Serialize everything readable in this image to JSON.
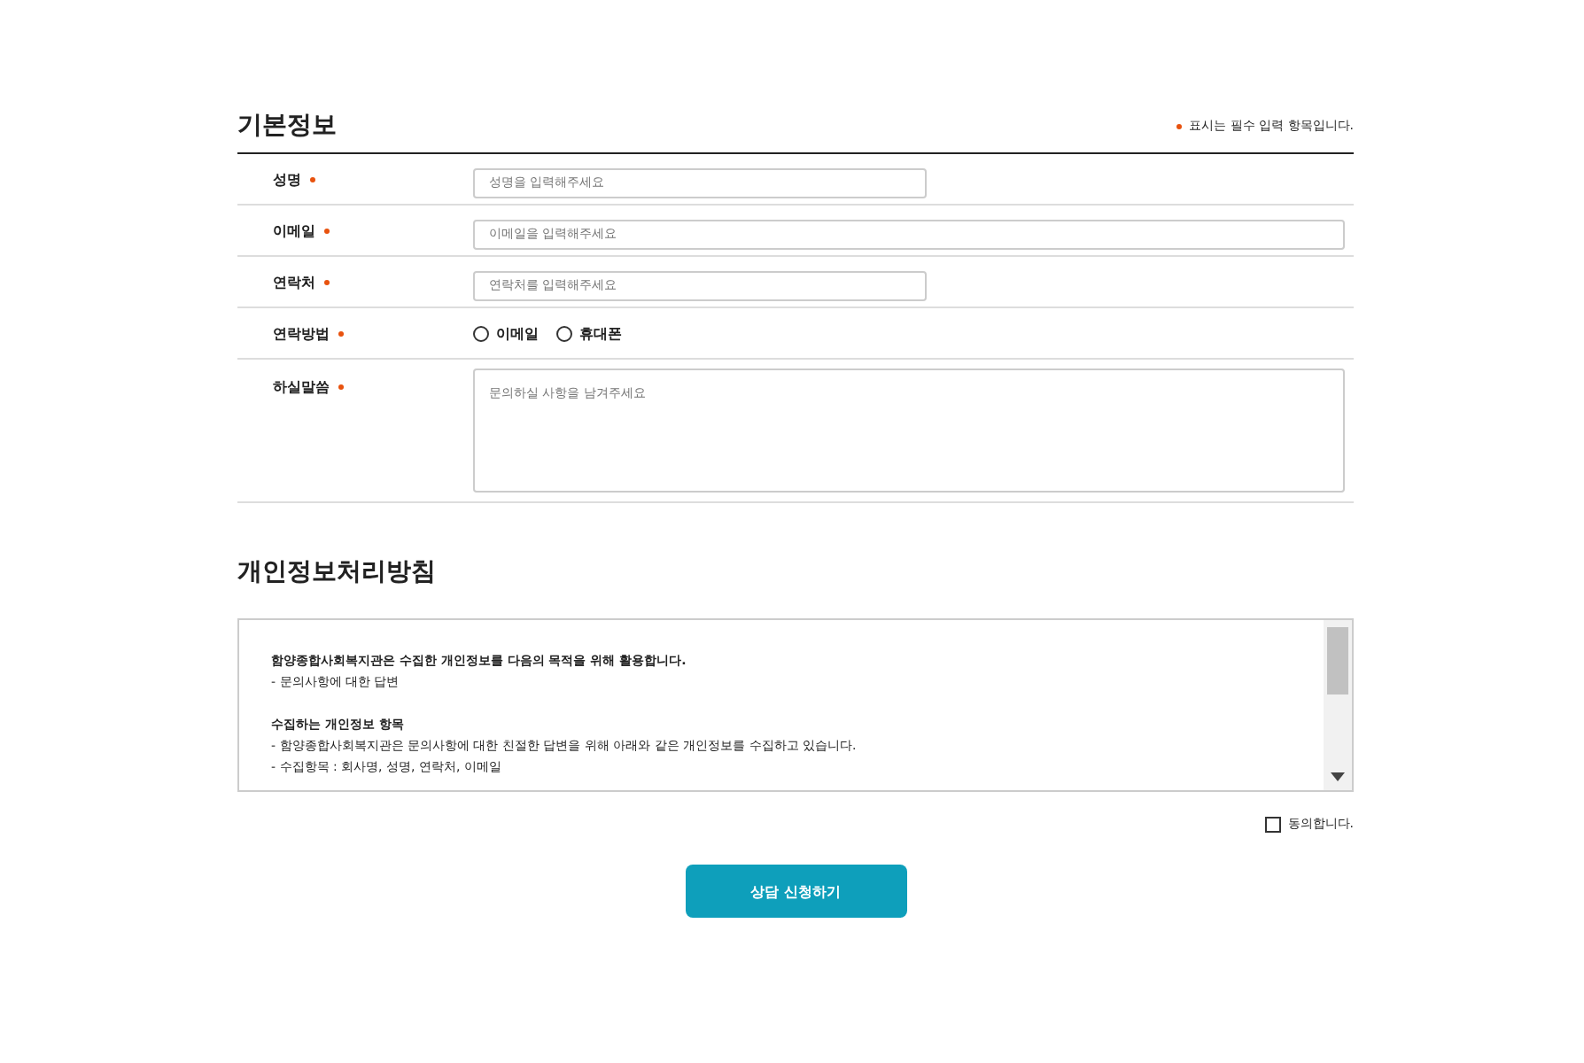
{
  "basic_info": {
    "title": "기본정보",
    "required_note": "표시는 필수 입력 항목입니다.",
    "fields": [
      {
        "label": "성명",
        "required": true,
        "kind": "text",
        "placeholder": "성명을 입력해주세요",
        "wide": false
      },
      {
        "label": "이메일",
        "required": true,
        "kind": "text",
        "placeholder": "이메일을 입력해주세요",
        "wide": true
      },
      {
        "label": "연락처",
        "required": true,
        "kind": "text",
        "placeholder": "연락처를 입력해주세요",
        "wide": false
      },
      {
        "label": "연락방법",
        "required": true,
        "kind": "radio",
        "options": [
          {
            "label": "이메일",
            "selected": false
          },
          {
            "label": "휴대폰",
            "selected": false
          }
        ]
      },
      {
        "label": "하실말씀",
        "required": true,
        "kind": "textarea",
        "placeholder": "문의하실 사항을 남겨주세요"
      }
    ]
  },
  "privacy": {
    "title": "개인정보처리방침",
    "lines": [
      {
        "text": "함양종합사회복지관은 수집한 개인정보를 다음의 목적을 위해 활용합니다.",
        "bold": true
      },
      {
        "text": "- 문의사항에 대한 답변",
        "bold": false
      },
      {
        "text": "수집하는 개인정보 항목",
        "bold": true,
        "gap": true
      },
      {
        "text": "- 함양종합사회복지관은 문의사항에 대한 친절한 답변을 위해 아래와 같은 개인정보를 수집하고 있습니다.",
        "bold": false
      },
      {
        "text": "- 수집항목 : 회사명, 성명, 연락처, 이메일",
        "bold": false
      }
    ],
    "agree": {
      "label": "동의합니다.",
      "checked": false
    }
  },
  "submit": "상담 신청하기"
}
